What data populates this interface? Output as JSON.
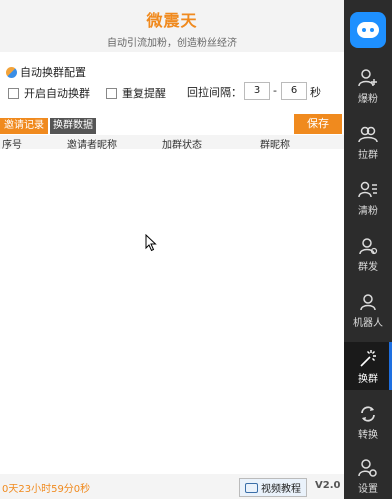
{
  "header": {
    "title": "微震天",
    "subtitle": "自动引流加粉，创造粉丝经济"
  },
  "config": {
    "title": "自动换群配置",
    "auto_switch_label": "开启自动换群",
    "repeat_remind_label": "重复提醒",
    "interval_label": "回拉间隔：",
    "interval_min": "3",
    "interval_max": "6",
    "dash": "-",
    "unit": "秒"
  },
  "tabs": {
    "invite_records": "邀请记录",
    "switch_data": "换群数据",
    "save": "保存"
  },
  "table": {
    "columns": [
      "序号",
      "邀请者昵称",
      "加群状态",
      "群昵称"
    ]
  },
  "footer": {
    "timer": "0天23小时59分0秒",
    "video_tutorial": "视频教程",
    "version": "V2.0"
  },
  "sidebar": {
    "items": [
      {
        "label": "爆粉",
        "icon": "add-user-icon"
      },
      {
        "label": "拉群",
        "icon": "group-icon"
      },
      {
        "label": "清粉",
        "icon": "user-list-icon"
      },
      {
        "label": "群发",
        "icon": "broadcast-icon"
      },
      {
        "label": "机器人",
        "icon": "robot-icon"
      },
      {
        "label": "换群",
        "icon": "magic-wand-icon"
      },
      {
        "label": "转换",
        "icon": "refresh-icon"
      },
      {
        "label": "设置",
        "icon": "settings-icon"
      }
    ],
    "active": "换群"
  },
  "colors": {
    "accent": "#f08a1e",
    "sidebar_bg": "#2c2c2c",
    "active_indicator": "#1e6fe0"
  }
}
